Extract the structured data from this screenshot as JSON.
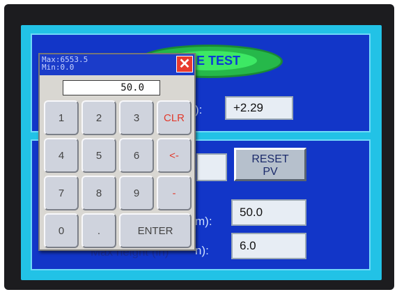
{
  "title_fragment": "E TEST",
  "label_fragments": {
    "top": "):",
    "middle": "m):",
    "bottom_dark": "Max height (in)",
    "bottom": "n):"
  },
  "values": {
    "top_box": "+2.29",
    "max_box": "50.0",
    "min_box": "6.0",
    "pv_box": ""
  },
  "reset_button": {
    "line1": "RESET",
    "line2": "PV"
  },
  "keypad": {
    "max_label": "Max:6553.5",
    "min_label": "Min:0.0",
    "close_symbol": "✕",
    "display_value": "50.0",
    "keys": [
      {
        "label": "1",
        "name": "key-1",
        "red": false
      },
      {
        "label": "2",
        "name": "key-2",
        "red": false
      },
      {
        "label": "3",
        "name": "key-3",
        "red": false
      },
      {
        "label": "CLR",
        "name": "key-clear",
        "red": true
      },
      {
        "label": "4",
        "name": "key-4",
        "red": false
      },
      {
        "label": "5",
        "name": "key-5",
        "red": false
      },
      {
        "label": "6",
        "name": "key-6",
        "red": false
      },
      {
        "label": "<-",
        "name": "key-backspace",
        "red": true
      },
      {
        "label": "7",
        "name": "key-7",
        "red": false
      },
      {
        "label": "8",
        "name": "key-8",
        "red": false
      },
      {
        "label": "9",
        "name": "key-9",
        "red": false
      },
      {
        "label": "-",
        "name": "key-minus",
        "red": true
      },
      {
        "label": "0",
        "name": "key-0",
        "red": false
      },
      {
        "label": ".",
        "name": "key-decimal",
        "red": false
      },
      {
        "label": "ENTER",
        "name": "key-enter",
        "red": false
      }
    ]
  },
  "colors": {
    "panel_blue": "#1236c8",
    "screen_cyan": "#22c2e6",
    "title_green": "#3de864",
    "close_red": "#e83a2f",
    "key_red": "#e23a2c"
  }
}
